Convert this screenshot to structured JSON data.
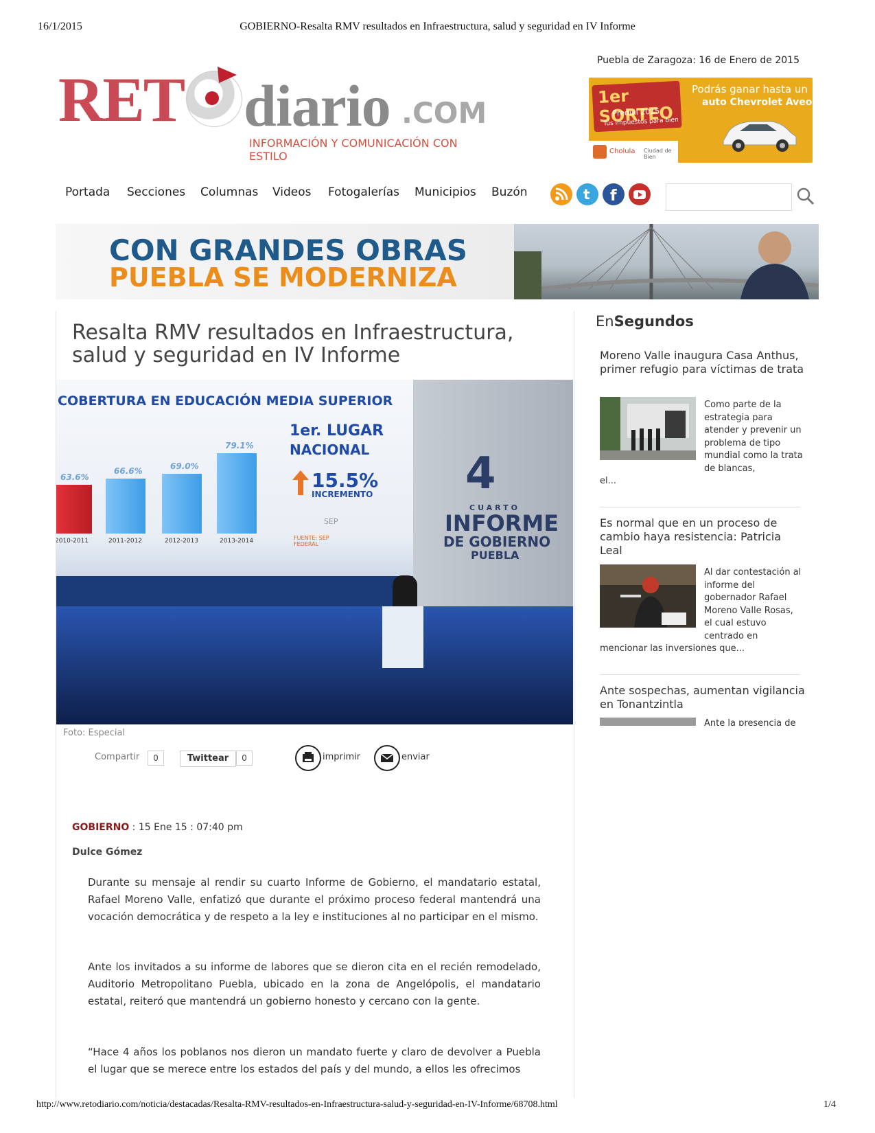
{
  "print": {
    "date": "16/1/2015",
    "title": "GOBIERNO-Resalta RMV resultados en Infraestructura, salud y seguridad en IV Informe",
    "url": "http://www.retodiario.com/noticia/destacadas/Resalta-RMV-resultados-en-Infraestructura-salud-y-seguridad-en-IV-Informe/68708.html",
    "page": "1/4"
  },
  "header": {
    "location_label": "Puebla de Zaragoza:",
    "location_date": " 16 de Enero de 2015",
    "logo": {
      "ret": "RET",
      "diario": "diario",
      "com": ".COM",
      "tagline": "INFORMACIÓN Y COMUNICACIÓN CON ESTILO"
    },
    "ad": {
      "badge": "1er SORTEO",
      "badge_sub": "Predial 2015",
      "badge_tiny": "Tus impuestos para bien",
      "line1": "Podrás ganar hasta un",
      "line2": "auto Chevrolet Aveo",
      "footer_left": "Cholula",
      "footer_right": "Ciudad de Bien"
    }
  },
  "nav": {
    "items": [
      "Portada",
      "Secciones",
      "Columnas",
      "Videos",
      "Fotogalerías",
      "Municipios",
      "Buzón"
    ],
    "social": [
      "rss-icon",
      "twitter-icon",
      "facebook-icon",
      "youtube-icon"
    ],
    "search_placeholder": ""
  },
  "banner": {
    "line1": "CON GRANDES OBRAS",
    "line2": "PUEBLA SE MODERNIZA"
  },
  "article": {
    "headline": "Resalta RMV resultados en Infraestructura, salud y seguridad en IV Informe",
    "photo": {
      "screen_title": "COBERTURA EN EDUCACIÓN MEDIA SUPERIOR",
      "bars": [
        {
          "label": "2010-2011",
          "value": "63.6%",
          "level": 63.6
        },
        {
          "label": "2011-2012",
          "value": "66.6%",
          "level": 66.6
        },
        {
          "label": "2012-2013",
          "value": "69.0%",
          "level": 69.0
        },
        {
          "label": "2013-2014",
          "value": "79.1%",
          "level": 79.1
        }
      ],
      "rank_line1": "1er. LUGAR",
      "rank_line2": "NACIONAL",
      "increase": "15.5%",
      "increase_label": "INCREMENTO",
      "source": "FUENTE: SEP FEDERAL",
      "sep": "SEP",
      "stage_number": "4",
      "stage_line1": "CUARTO",
      "stage_line2": "INFORME",
      "stage_line3": "DE GOBIERNO",
      "stage_line4": "PUEBLA"
    },
    "caption": "Foto: Especial",
    "share": {
      "compartir": "Compartir",
      "compartir_count": "0",
      "twitter": "Twittear",
      "twitter_count": "0",
      "print": "imprimir",
      "send": "enviar"
    },
    "section": "GOBIERNO",
    "meta": " : 15 Ene 15 : 07:40 pm",
    "author": "Dulce Gómez",
    "paragraphs": [
      "Durante su mensaje al rendir su cuarto Informe de Gobierno, el mandatario estatal, Rafael Moreno Valle, enfatizó que durante el próximo proceso federal mantendrá una vocación democrática y de respeto a la ley e instituciones al no participar en el mismo.",
      "Ante los invitados a su informe de labores que se dieron cita en el recién remodelado, Auditorio Metropolitano Puebla, ubicado en la zona de Angelópolis, el mandatario estatal, reiteró que mantendrá un gobierno honesto y cercano con la gente.",
      "“Hace 4 años los poblanos nos dieron un mandato fuerte y claro de devolver a Puebla el lugar que se merece entre los estados del país y del mundo, a ellos les ofrecimos"
    ]
  },
  "sidebar": {
    "title_en": "En",
    "title_segundos": "Segundos",
    "items": [
      {
        "title": "Moreno Valle inaugura Casa Anthus, primer refugio para víctimas de trata",
        "text": "Como parte de la estrategia para atender y prevenir un problema de tipo mundial como la trata de blancas,",
        "rest": "el..."
      },
      {
        "title": "Es normal que en un proceso de cambio haya resistencia: Patricia Leal",
        "text": "Al dar contestación al informe del gobernador Rafael Moreno Valle Rosas, el cual estuvo centrado en",
        "rest": "mencionar las inversiones que..."
      },
      {
        "title": "Ante sospechas, aumentan vigilancia en Tonantzintla",
        "text": "Ante la presencia de",
        "rest": ""
      }
    ]
  }
}
